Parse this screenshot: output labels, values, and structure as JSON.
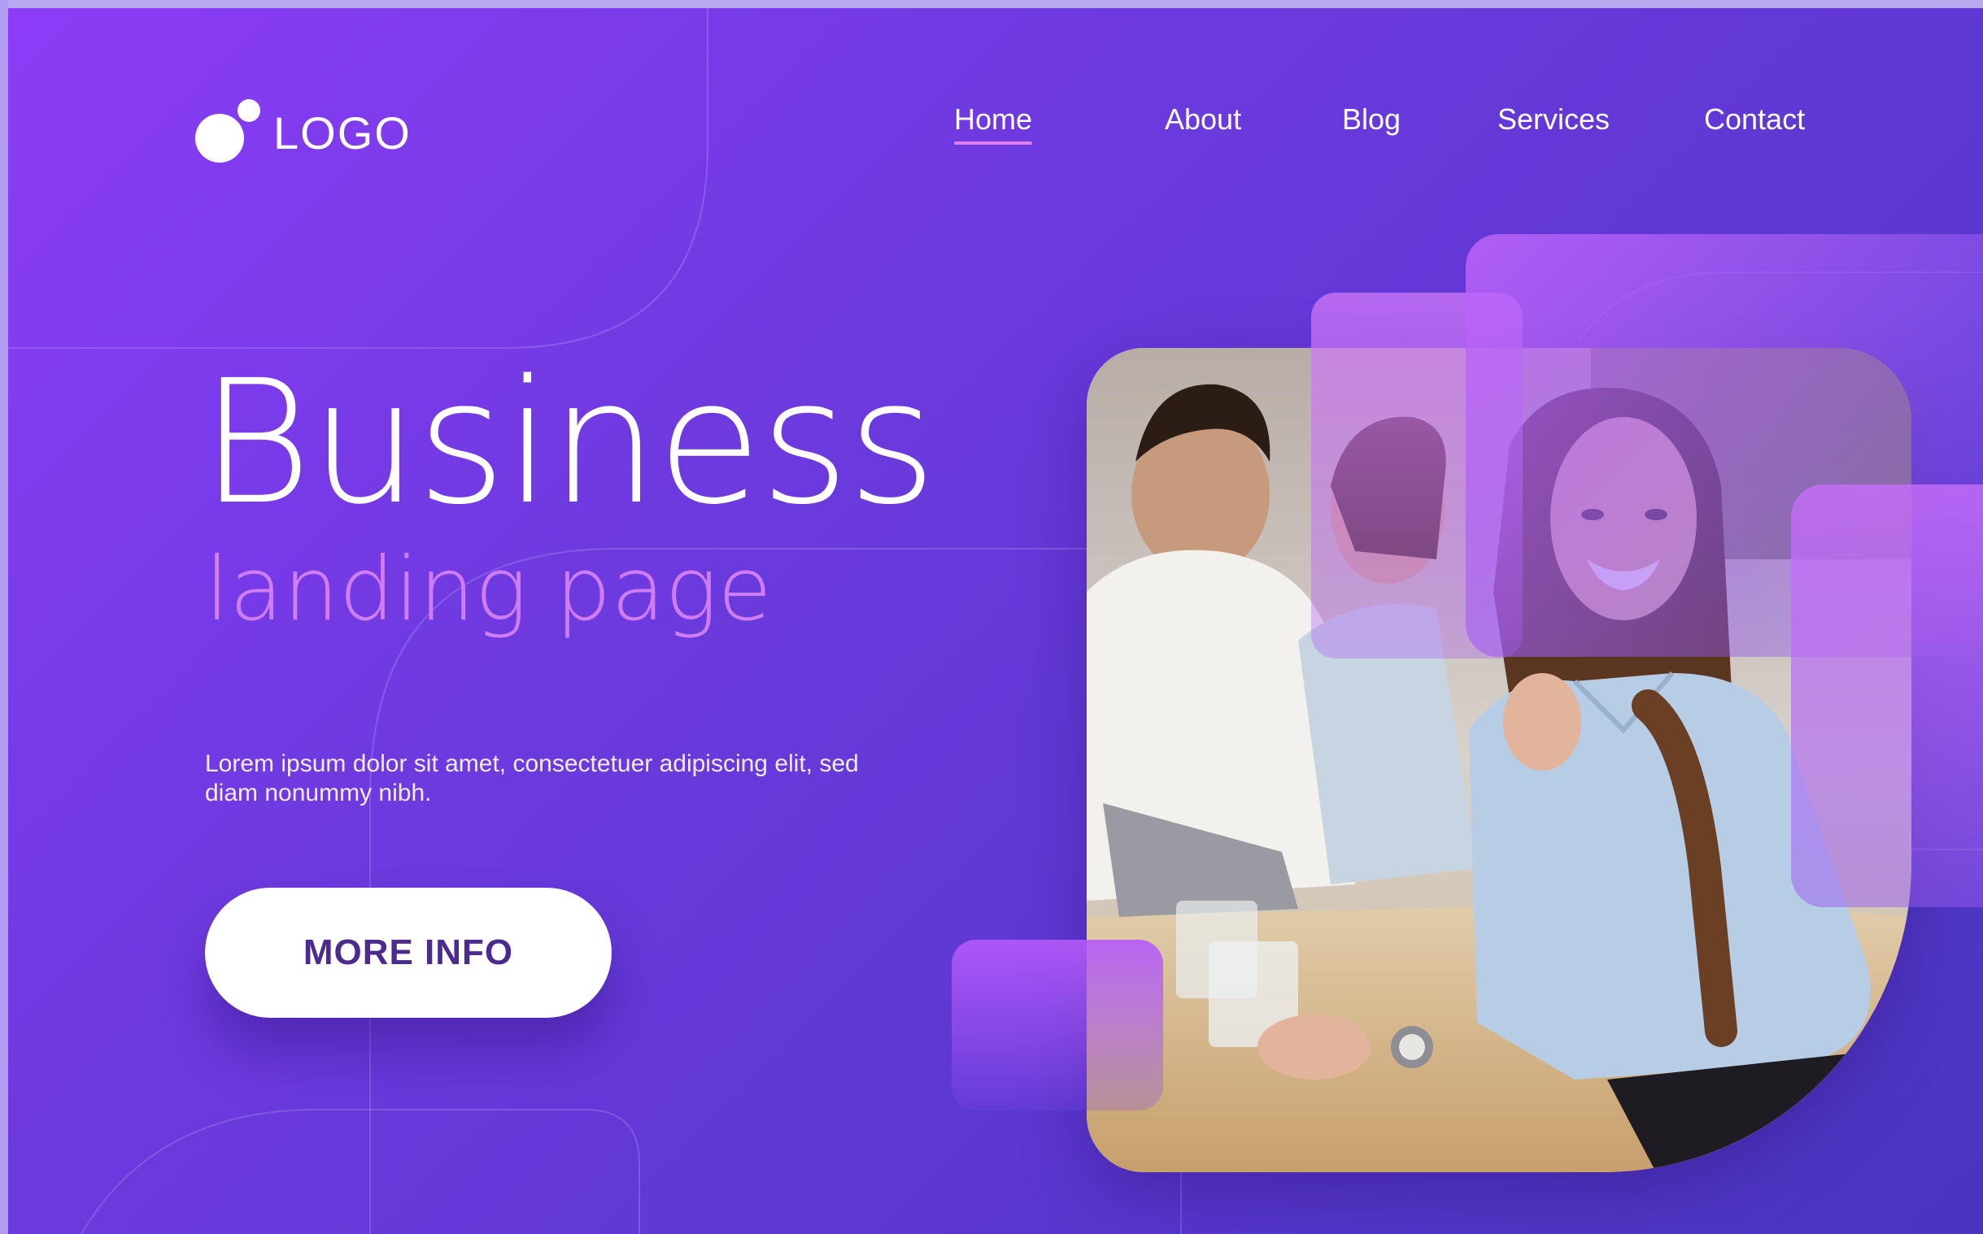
{
  "header": {
    "logo_text": "LOGO",
    "nav": [
      {
        "label": "Home",
        "active": true
      },
      {
        "label": "About",
        "active": false
      },
      {
        "label": "Blog",
        "active": false
      },
      {
        "label": "Services",
        "active": false
      },
      {
        "label": "Contact",
        "active": false
      }
    ]
  },
  "hero": {
    "title": "Business",
    "subtitle": "landing page",
    "description": "Lorem ipsum dolor sit amet, consectetuer adipiscing elit, sed diam nonummy nibh.",
    "cta_label": "MORE INFO"
  },
  "colors": {
    "background_start": "#8d3cf7",
    "background_end": "#4a35bf",
    "accent_pink": "#d07cf2",
    "cta_text": "#4c2a8f"
  },
  "icons": {
    "logo_mark": "logo-dots-icon"
  }
}
